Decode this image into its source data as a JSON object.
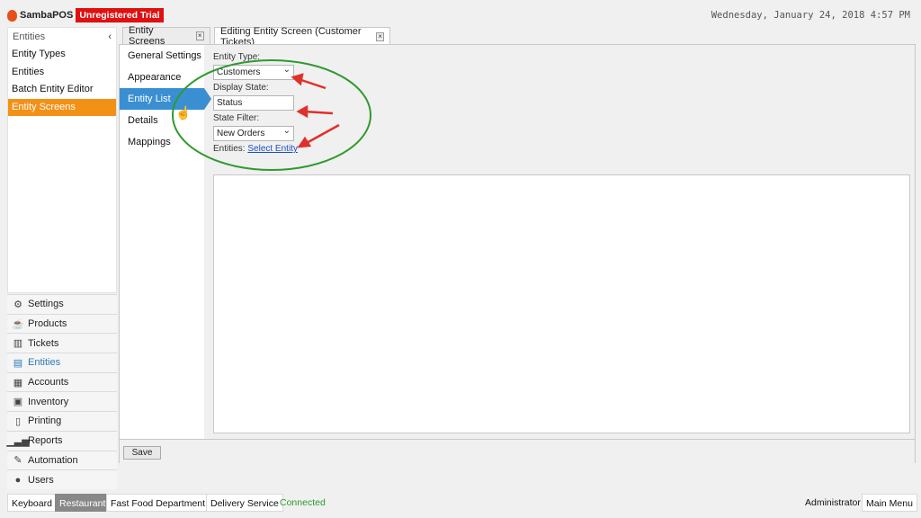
{
  "app": {
    "name": "SambaPOS",
    "trial_badge": "Unregistered Trial",
    "datetime": "Wednesday, January 24, 2018 4:57 PM"
  },
  "sidebar": {
    "header": "Entities",
    "collapse_icon": "chevron-left-icon",
    "items": [
      {
        "label": "Entity Types"
      },
      {
        "label": "Entities"
      },
      {
        "label": "Batch Entity Editor"
      },
      {
        "label": "Entity Screens",
        "active": true
      }
    ],
    "nav": [
      {
        "label": "Settings",
        "icon": "gear-icon"
      },
      {
        "label": "Products",
        "icon": "coffee-icon"
      },
      {
        "label": "Tickets",
        "icon": "books-icon"
      },
      {
        "label": "Entities",
        "icon": "table-icon",
        "active": true
      },
      {
        "label": "Accounts",
        "icon": "calculator-icon"
      },
      {
        "label": "Inventory",
        "icon": "boxes-icon"
      },
      {
        "label": "Printing",
        "icon": "document-icon"
      },
      {
        "label": "Reports",
        "icon": "bar-chart-icon"
      },
      {
        "label": "Automation",
        "icon": "pen-icon"
      },
      {
        "label": "Users",
        "icon": "user-icon"
      }
    ]
  },
  "tabs": [
    {
      "label": "Entity Screens",
      "active": false
    },
    {
      "label": "Editing Entity Screen (Customer Tickets)",
      "active": true
    }
  ],
  "subnav": [
    {
      "label": "General Settings"
    },
    {
      "label": "Appearance"
    },
    {
      "label": "Entity List",
      "active": true
    },
    {
      "label": "Details"
    },
    {
      "label": "Mappings"
    }
  ],
  "form": {
    "entity_type_label": "Entity Type:",
    "entity_type_value": "Customers",
    "display_state_label": "Display State:",
    "display_state_value": "Status",
    "state_filter_label": "State Filter:",
    "state_filter_value": "New Orders",
    "entities_label": "Entities:",
    "select_entity_link": "Select Entity"
  },
  "save_label": "Save",
  "statusbar": {
    "keyboard": "Keyboard",
    "restaurant": "Restaurant",
    "department": "Fast Food Department",
    "delivery": "Delivery Service",
    "connection": "Connected",
    "user": "Administrator",
    "main_menu": "Main Menu"
  },
  "colors": {
    "accent_orange": "#f39117",
    "accent_blue": "#3a8fd2",
    "trial_red": "#e01010",
    "annotation_green": "#2e9a2e",
    "annotation_red": "#e0302a",
    "connected_green": "#2a9a2a"
  }
}
